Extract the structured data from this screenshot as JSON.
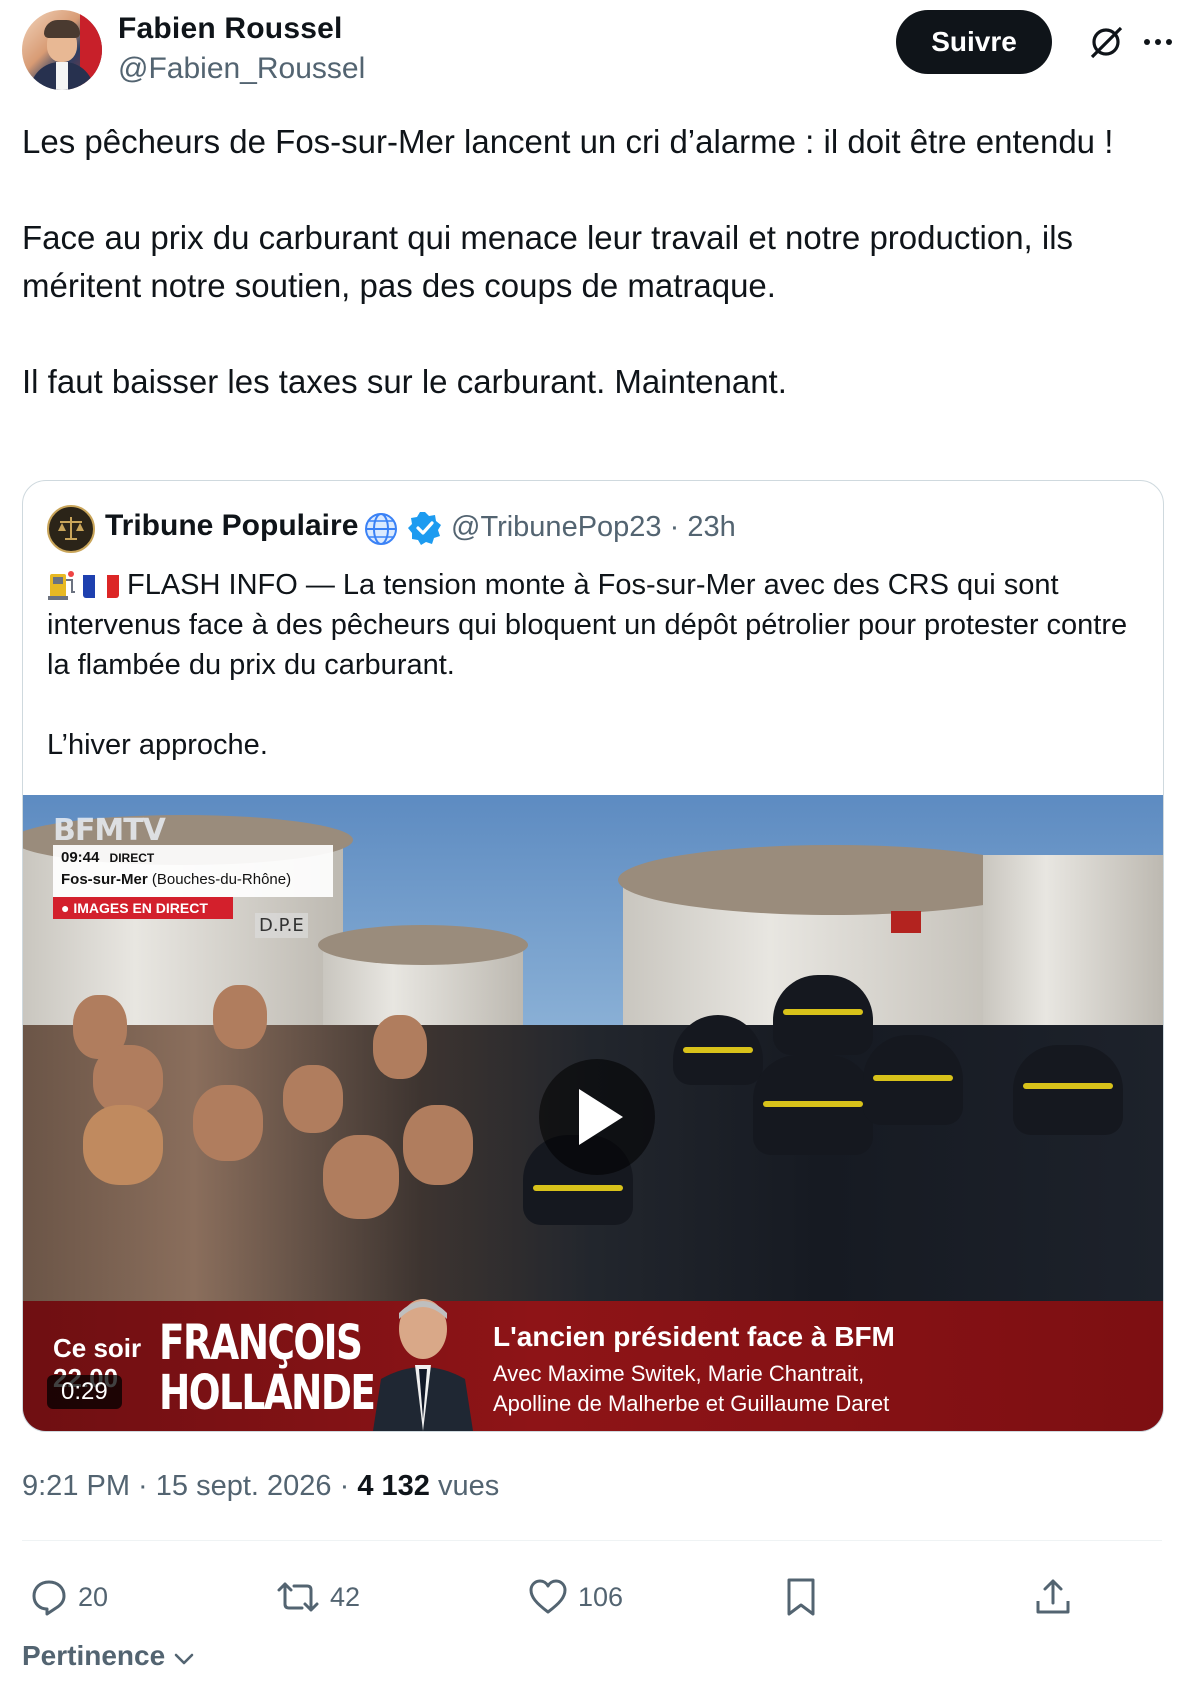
{
  "author": {
    "name": "Fabien Roussel",
    "handle": "@Fabien_Roussel",
    "follow_label": "Suivre"
  },
  "tweet": {
    "paragraphs": [
      "Les pêcheurs de Fos-sur-Mer lancent un cri d’alarme : il doit être entendu !",
      "Face au prix du carburant qui menace leur travail et notre production, ils méritent notre soutien, pas des coups de matraque.",
      "Il faut baisser les taxes sur le carburant. Maintenant."
    ]
  },
  "quote": {
    "name": "Tribune Populaire",
    "handle_time": "@TribunePop23 · 23h",
    "text_line1": "FLASH INFO — La tension monte à Fos-sur-Mer avec des CRS qui sont intervenus face à des pêcheurs qui bloquent un dépôt pétrolier pour protester contre la flambée du prix du carburant.",
    "text_line2": "L’hiver approche.",
    "video": {
      "logo": "BFMTV",
      "time": "09:44",
      "live_tag": "DIRECT",
      "location": "Fos-sur-Mer",
      "region": "(Bouches-du-Rhône)",
      "live_badge": "● IMAGES EN DIRECT",
      "sign": "D.P.E",
      "banner_ce_soir": "Ce soir",
      "banner_hour": "22.00",
      "banner_name1": "FRANÇOIS",
      "banner_name2": "HOLLANDE",
      "banner_title": "L'ancien président face à BFM",
      "banner_sub1": "Avec Maxime Switek, Marie Chantrait,",
      "banner_sub2": "Apolline de Malherbe et Guillaume Daret",
      "duration": "0:29"
    }
  },
  "meta": {
    "time_date": "9:21 PM · 15 sept. 2026 · ",
    "views_count": "4 132",
    "views_label": " vues"
  },
  "actions": {
    "replies": "20",
    "reposts": "42",
    "likes": "106"
  },
  "sort_label": "Pertinence",
  "colors": {
    "text": "#0f1419",
    "secondary": "#536471",
    "verified": "#1d9bf0",
    "border": "#cfd9de"
  }
}
